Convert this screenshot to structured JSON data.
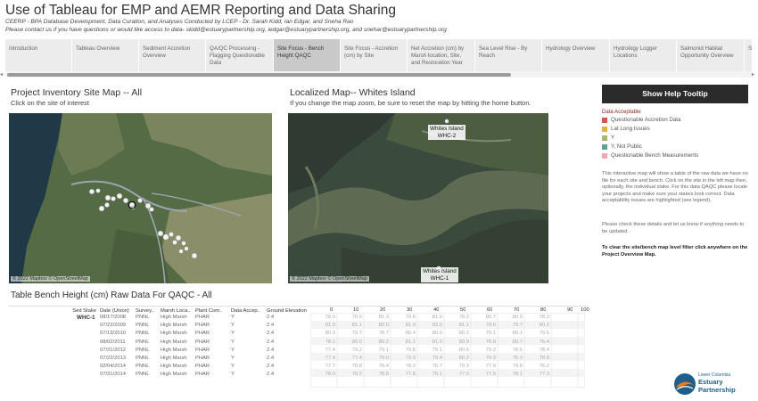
{
  "header": {
    "title": "Use of Tableau for EMP and AEMR Reporting and Data Sharing",
    "subtitle1": "CEERP - BPA Database Development, Data Curation, and Analyses Conducted by LCEP - Dr. Sarah Kidd, Ian Edgar, and Sneha Rao",
    "subtitle2": "Please contact us if you have questions or would like access to data- skidd@estuarypartnership.org,  iedgar@estuarypartnership.org, and snehar@estuarypartnership.org"
  },
  "tabs": [
    {
      "label": "Introduction",
      "active": false
    },
    {
      "label": "Tableau Overview",
      "active": false
    },
    {
      "label": "Sediment Accretion Overview",
      "active": false
    },
    {
      "label": "QA/QC Processing - Flagging Questionable Data",
      "active": false
    },
    {
      "label": "Site Focus - Bench Height QAQC",
      "active": true
    },
    {
      "label": "Site Focus - Accretion (cm) by Site",
      "active": false
    },
    {
      "label": "Net Accretion (cm) by Marsh location, Site, and Restoration Year",
      "active": false
    },
    {
      "label": "Sea Level Rise - By Reach",
      "active": false
    },
    {
      "label": "Hydrology Overview",
      "active": false
    },
    {
      "label": "Hydrology Logger Locations",
      "active": false
    },
    {
      "label": "Salmonid Habitat Opportunity Overview",
      "active": false
    },
    {
      "label": "S",
      "active": false
    }
  ],
  "scrollbar": {
    "left_arrow": "◂",
    "right_arrow": "▸"
  },
  "map1": {
    "title": "Project Inventory Site Map -- All",
    "instruction": "Click on the site of interest",
    "credit": "© 2022 Mapbox © OpenStreetMap"
  },
  "map2": {
    "title": "Localized Map-- Whites Island",
    "instruction": "If you change the map zoom, be sure to reset the map by hitting the home button.",
    "credit": "© 2022 Mapbox © OpenStreetMap",
    "labels": [
      {
        "line1": "Whites Island",
        "line2": "WHC-2"
      },
      {
        "line1": "Whites Island",
        "line2": "WHC-1"
      }
    ]
  },
  "sidebar": {
    "help_button": "Show Help Tooltip",
    "legend_title": "Data Acceptable",
    "legend": [
      {
        "label": "Questionable Accretion Data",
        "color": "#d9534f"
      },
      {
        "label": "Lat Long Issues",
        "color": "#e2b43a"
      },
      {
        "label": "Y",
        "color": "#a8b66b"
      },
      {
        "label": "Y, Not Public",
        "color": "#5aa39a"
      },
      {
        "label": "Questionable Bench Measurements",
        "color": "#f2a7b0"
      }
    ],
    "para1": "This interactive map will show a table of the raw data we have on file for each site and bench. Click on the site in the left map then, optionally, the individual stake. For this data QAQC please locate your projects and make sure your stakes look correct. Data acceptability issues are highlighted (see legend).",
    "para2": "Please check these details and let us know if anything needs to be updated.",
    "clear_note": "To clear the site/bench map level filter click anywhere on the Project Overview Map."
  },
  "table": {
    "title": "Table Bench Height (cm) Raw Data For QAQC - All",
    "headers": [
      "Sed Stake",
      "Date (Union)",
      "Survey..",
      "Marsh Loca..",
      "Plant Com..",
      "Data Accep..",
      "Ground Elevation"
    ],
    "col_numbers": [
      "0",
      "10",
      "20",
      "30",
      "40",
      "50",
      "60",
      "70",
      "80",
      "90",
      "100"
    ],
    "stake": "WHC-1",
    "rows": [
      {
        "date": "08/17/2008",
        "survey": "PNNL",
        "marsh": "High Marsh",
        "plant": "PHAR",
        "accept": "Y",
        "ground": "2.4",
        "vals": [
          "78.9",
          "76.0",
          "81.3",
          "79.6",
          "81.0",
          "78.2",
          "80.7",
          "80.9",
          "78.3"
        ]
      },
      {
        "date": "07/22/2009",
        "survey": "PNNL",
        "marsh": "High Marsh",
        "plant": "PHAR",
        "accept": "Y",
        "ground": "2.4",
        "vals": [
          "81.9",
          "81.1",
          "80.0",
          "81.4",
          "83.0",
          "81.1",
          "79.6",
          "79.7",
          "80.2"
        ]
      },
      {
        "date": "07/13/2010",
        "survey": "PNNL",
        "marsh": "High Marsh",
        "plant": "PHAR",
        "accept": "Y",
        "ground": "2.4",
        "vals": [
          "80.0",
          "79.7",
          "78.7",
          "80.4",
          "80.9",
          "80.2",
          "79.1",
          "80.1",
          "79.5"
        ]
      },
      {
        "date": "08/02/2011",
        "survey": "PNNL",
        "marsh": "High Marsh",
        "plant": "PHAR",
        "accept": "Y",
        "ground": "2.4",
        "vals": [
          "78.1",
          "80.0",
          "80.2",
          "81.1",
          "81.0",
          "80.9",
          "78.8",
          "80.7",
          "76.4"
        ]
      },
      {
        "date": "07/31/2012",
        "survey": "PNNL",
        "marsh": "High Marsh",
        "plant": "PHAR",
        "accept": "Y",
        "ground": "2.4",
        "vals": [
          "77.4",
          "79.2",
          "79.1",
          "79.8",
          "79.1",
          "80.6",
          "79.2",
          "78.6",
          "78.4"
        ]
      },
      {
        "date": "07/22/2013",
        "survey": "PNNL",
        "marsh": "High Marsh",
        "plant": "PHAR",
        "accept": "Y",
        "ground": "2.4",
        "vals": [
          "77.4",
          "77.4",
          "79.0",
          "79.9",
          "79.4",
          "80.2",
          "79.3",
          "76.3",
          "78.8"
        ]
      },
      {
        "date": "02/04/2014",
        "survey": "PNNL",
        "marsh": "High Marsh",
        "plant": "PHAR",
        "accept": "Y",
        "ground": "2.4",
        "vals": [
          "77.7",
          "78.8",
          "78.4",
          "78.3",
          "76.7",
          "79.3",
          "77.9",
          "79.8",
          "76.2"
        ]
      },
      {
        "date": "07/31/2014",
        "survey": "PNNL",
        "marsh": "High Marsh",
        "plant": "PHAR",
        "accept": "Y",
        "ground": "2.4",
        "vals": [
          "78.0",
          "79.2",
          "78.8",
          "77.8",
          "76.1",
          "77.0",
          "77.5",
          "78.1",
          "77.3"
        ]
      }
    ]
  },
  "logo": {
    "line1": "Lower Columbia",
    "line2": "Estuary",
    "line3": "Partnership"
  }
}
